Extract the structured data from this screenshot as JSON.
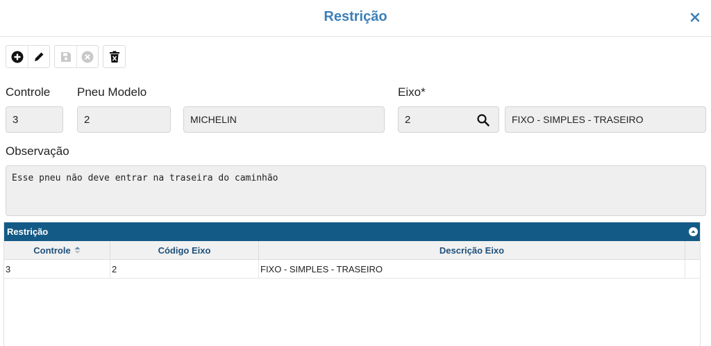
{
  "dialog": {
    "title": "Restrição"
  },
  "toolbar": {
    "buttons": [
      "add-icon",
      "edit-icon",
      "save-icon",
      "cancel-icon",
      "delete-icon"
    ]
  },
  "form": {
    "controle": {
      "label": "Controle",
      "value": "3"
    },
    "pneu_modelo": {
      "label": "Pneu Modelo",
      "value": "2",
      "description": "MICHELIN"
    },
    "eixo": {
      "label": "Eixo*",
      "value": "2",
      "description": "FIXO - SIMPLES - TRASEIRO"
    },
    "observacao": {
      "label": "Observação",
      "value": "Esse pneu não deve entrar na traseira do caminhão"
    }
  },
  "grid": {
    "title": "Restrição",
    "columns": [
      "Controle",
      "Código Eixo",
      "Descrição Eixo"
    ],
    "rows": [
      [
        "3",
        "2",
        "FIXO - SIMPLES - TRASEIRO"
      ]
    ]
  },
  "colors": {
    "accent": "#3b7fb8",
    "grid_header": "#145a86",
    "column_text": "#1e4f7a"
  }
}
